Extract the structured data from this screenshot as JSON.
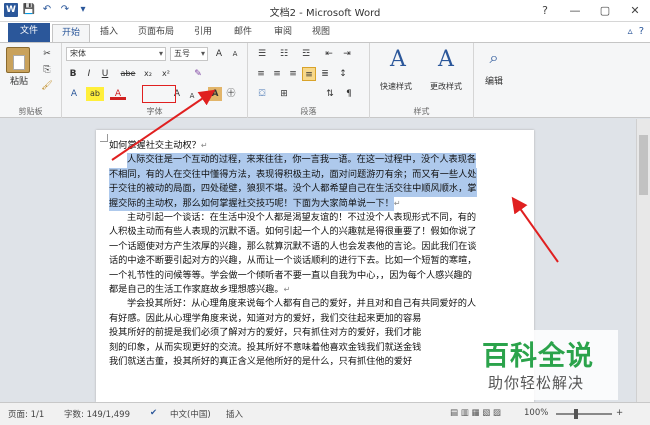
{
  "window": {
    "title": "文档2 - Microsoft Word",
    "controls": [
      "?",
      "—",
      "▢",
      "✕"
    ]
  },
  "qat": [
    "W",
    "💾",
    "↶",
    "↷",
    "▾"
  ],
  "tabs": [
    {
      "label": "文件"
    },
    {
      "label": "开始"
    },
    {
      "label": "插入"
    },
    {
      "label": "页面布局"
    },
    {
      "label": "引用"
    },
    {
      "label": "邮件"
    },
    {
      "label": "审阅"
    },
    {
      "label": "视图"
    }
  ],
  "ribbon": {
    "clipboard": {
      "label": "剪贴板",
      "paste": "粘贴"
    },
    "font": {
      "label": "字体",
      "font_name": "宋体",
      "font_size": "五号",
      "buttons": [
        "B",
        "I",
        "U",
        "abe",
        "x₂",
        "x²",
        "A",
        "A"
      ]
    },
    "paragraph": {
      "label": "段落"
    },
    "styles": {
      "label": "样式",
      "quick": "快速样式",
      "change": "更改样式"
    },
    "editing": {
      "label": "编辑"
    }
  },
  "document": {
    "heading": "如何掌握社交主动权？",
    "para1_selected": [
      "人际交往是一个互动的过程，来来往往，你一言我一语。在这一过程中，没个人表现各",
      "不相同，有的人在交往中懂得方法，表现得积极主动，面对问题游刃有余；而又有一些人处",
      "于交往的被动的局面，四处碰壁，狼狈不堪。没个人都希望自己在生活交往中顺风顺水，掌",
      "握交际的主动权，那么如何掌握社交技巧呢！下面为大家简单说一下！"
    ],
    "para2": [
      "主动引起一个谈话：在生活中没个人都是渴望友谊的！不过没个人表现形式不同，有的",
      "人积极主动而有些人表现的沉默不语。如何引起一个人的兴趣就是得很重要了！假如你说了",
      "一个话题使对方产生浓厚的兴趣，那么就算沉默不语的人也会发表他的言论。因此我们在谈",
      "话的中途不断要引起对方的兴趣，从而让一个谈话顺利的进行下去。比如一个短暂的寒暄，",
      "一个礼节性的问候等等。学会做一个倾听者不要一直以自我为中心，，因为每个人感兴趣的",
      "都是自己的生活工作家庭故乡理想感兴趣。"
    ],
    "para3": [
      "学会投其所好：从心理角度来说每个人都有自己的爱好，并且对和自己有共同爱好的人",
      "有好感。因此从心理学角度来说，知道对方的爱好，我们交往起来更加的容易",
      "投其所好的前提是我们必须了解对方的爱好，只有抓住对方的爱好，我们才能",
      "刻的印象，从而实现更好的交流。投其所好不意味着他喜欢金钱我们就送金钱",
      "我们就送古董，投其所好的真正含义是他所好的是什么，只有抓住他的爱好"
    ],
    "para_mark": "↵"
  },
  "statusbar": {
    "page": "页面: 1/1",
    "words": "字数: 149/1,499",
    "language": "中文(中国)",
    "mode": "插入",
    "zoom": "100%"
  },
  "watermark": {
    "main": "百科全说",
    "sub": "助你轻松解决"
  },
  "colors": {
    "accent": "#2b579a",
    "selection": "#aec9ec",
    "arrow": "#e02020",
    "watermark": "#2ba34b"
  }
}
